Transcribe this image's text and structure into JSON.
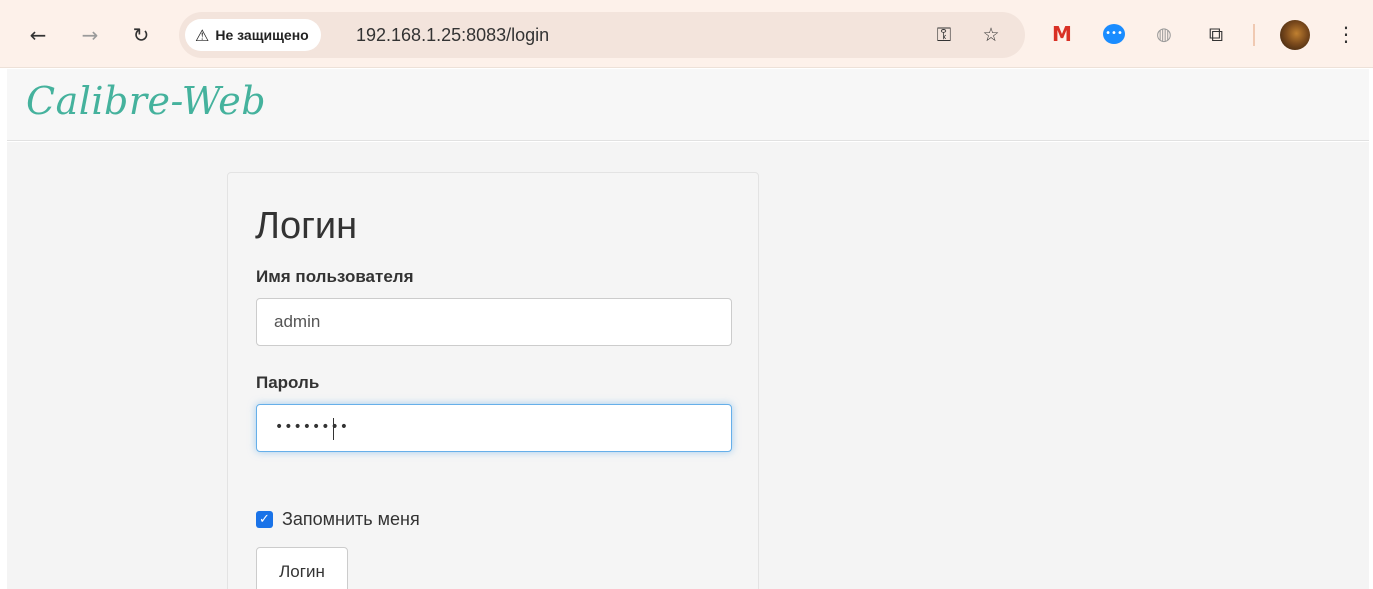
{
  "browser": {
    "security_label": "Не защищено",
    "url": "192.168.1.25:8083/login",
    "icons": {
      "back": "back-arrow-icon",
      "forward": "forward-arrow-icon",
      "reload": "reload-icon",
      "warning": "warning-triangle-icon",
      "key": "key-icon",
      "star": "bookmark-star-icon",
      "gmail": "gmail-icon",
      "chat": "chat-bubble-icon",
      "globe": "globe-icon",
      "extensions": "puzzle-icon",
      "menu": "kebab-menu-icon"
    }
  },
  "app": {
    "brand": "Calibre-Web",
    "brand_color": "#45b29d"
  },
  "login": {
    "title": "Логин",
    "username_label": "Имя пользователя",
    "username_value": "admin",
    "password_label": "Пароль",
    "password_masked": "••••••••",
    "remember_label": "Запомнить меня",
    "remember_checked": true,
    "submit_label": "Логин"
  },
  "colors": {
    "toolbar_bg": "#fdf1ea",
    "focus_ring": "#66afe9",
    "checkbox": "#1a73e8"
  }
}
